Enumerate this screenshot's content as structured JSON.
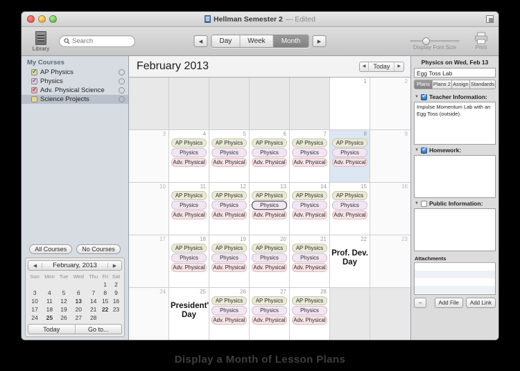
{
  "window": {
    "title": "Hellman Semester 2",
    "edited_suffix": "— Edited",
    "doc_icon": "document-icon",
    "fullscreen_icon": "fullscreen-icon"
  },
  "toolbar": {
    "library_label": "Library",
    "library_icon": "library-icon",
    "search_placeholder": "Search",
    "search_value": "",
    "search_icon": "search-icon",
    "prev_icon": "chevron-left-icon",
    "next_icon": "chevron-right-icon",
    "views": [
      {
        "label": "Day",
        "active": false
      },
      {
        "label": "Week",
        "active": false
      },
      {
        "label": "Month",
        "active": true
      }
    ],
    "font_size_label": "Display Font Size",
    "print_label": "Print",
    "print_icon": "printer-icon"
  },
  "sidebar": {
    "header": "My Courses",
    "items": [
      {
        "label": "AP Physics",
        "checked": true,
        "color": "#e9e9d6",
        "selected": false,
        "gear_icon": "gear-icon"
      },
      {
        "label": "Physics",
        "checked": true,
        "color": "#f1e6f1",
        "selected": false,
        "gear_icon": "gear-icon"
      },
      {
        "label": "Adv. Physical Science",
        "checked": true,
        "color": "#f6e3e5",
        "selected": false,
        "gear_icon": "gear-icon"
      },
      {
        "label": "Science Projects",
        "checked": false,
        "color": "#e8d98a",
        "selected": true,
        "gear_icon": "gear-icon"
      }
    ],
    "all_courses_label": "All Courses",
    "no_courses_label": "No Courses",
    "mini_calendar": {
      "title": "February, 2013",
      "prev_icon": "chevron-left-icon",
      "next_icon": "chevron-right-icon",
      "weekday_headers": [
        "Sun",
        "Mon",
        "Tue",
        "Wed",
        "Thu",
        "Fri",
        "Sat"
      ],
      "weeks": [
        [
          {
            "d": "",
            "style": "dim"
          },
          {
            "d": "",
            "style": "dim"
          },
          {
            "d": "",
            "style": "dim"
          },
          {
            "d": "",
            "style": "dim"
          },
          {
            "d": "",
            "style": "dim"
          },
          {
            "d": "1",
            "style": "dim"
          },
          {
            "d": "2",
            "style": "dim"
          }
        ],
        [
          {
            "d": "3",
            "style": "dim"
          },
          {
            "d": "4",
            "style": ""
          },
          {
            "d": "5",
            "style": ""
          },
          {
            "d": "6",
            "style": ""
          },
          {
            "d": "7",
            "style": ""
          },
          {
            "d": "8",
            "style": "blue"
          },
          {
            "d": "9",
            "style": "dim"
          }
        ],
        [
          {
            "d": "10",
            "style": "dim"
          },
          {
            "d": "11",
            "style": ""
          },
          {
            "d": "12",
            "style": ""
          },
          {
            "d": "13",
            "style": "today"
          },
          {
            "d": "14",
            "style": ""
          },
          {
            "d": "15",
            "style": ""
          },
          {
            "d": "16",
            "style": "dim"
          }
        ],
        [
          {
            "d": "17",
            "style": "dim"
          },
          {
            "d": "18",
            "style": ""
          },
          {
            "d": "19",
            "style": ""
          },
          {
            "d": "20",
            "style": ""
          },
          {
            "d": "21",
            "style": ""
          },
          {
            "d": "22",
            "style": "green"
          },
          {
            "d": "23",
            "style": "dim"
          }
        ],
        [
          {
            "d": "24",
            "style": "dim"
          },
          {
            "d": "25",
            "style": "green"
          },
          {
            "d": "26",
            "style": ""
          },
          {
            "d": "27",
            "style": ""
          },
          {
            "d": "28",
            "style": ""
          },
          {
            "d": "",
            "style": "dim"
          },
          {
            "d": "",
            "style": "dim"
          }
        ]
      ],
      "today_label": "Today",
      "goto_label": "Go to..."
    }
  },
  "calendar": {
    "title": "February 2013",
    "prev_icon": "chevron-left-icon",
    "next_icon": "chevron-right-icon",
    "today_label": "Today",
    "weeks": [
      [
        {
          "day": "",
          "state": "outside",
          "events": []
        },
        {
          "day": "",
          "state": "outside",
          "events": []
        },
        {
          "day": "",
          "state": "outside",
          "events": []
        },
        {
          "day": "",
          "state": "outside",
          "events": []
        },
        {
          "day": "",
          "state": "outside",
          "events": []
        },
        {
          "day": "1",
          "state": "normal",
          "events": []
        },
        {
          "day": "2",
          "state": "weekend",
          "events": []
        }
      ],
      [
        {
          "day": "3",
          "state": "weekend",
          "events": []
        },
        {
          "day": "4",
          "state": "normal",
          "events": [
            {
              "label": "AP Physics",
              "cls": "ap"
            },
            {
              "label": "Physics",
              "cls": "phys"
            },
            {
              "label": "Adv. Physical",
              "cls": "advp"
            }
          ]
        },
        {
          "day": "5",
          "state": "normal",
          "events": [
            {
              "label": "AP Physics",
              "cls": "ap"
            },
            {
              "label": "Physics",
              "cls": "phys"
            },
            {
              "label": "Adv. Physical",
              "cls": "advp"
            }
          ]
        },
        {
          "day": "6",
          "state": "normal",
          "events": [
            {
              "label": "AP Physics",
              "cls": "ap"
            },
            {
              "label": "Physics",
              "cls": "phys"
            },
            {
              "label": "Adv. Physical",
              "cls": "advp"
            }
          ]
        },
        {
          "day": "7",
          "state": "normal",
          "events": [
            {
              "label": "AP Physics",
              "cls": "ap"
            },
            {
              "label": "Physics",
              "cls": "phys"
            },
            {
              "label": "Adv. Physical",
              "cls": "advp"
            }
          ]
        },
        {
          "day": "8",
          "state": "highlight",
          "events": [
            {
              "label": "AP Physics",
              "cls": "ap"
            },
            {
              "label": "Physics",
              "cls": "phys"
            },
            {
              "label": "Adv. Physical",
              "cls": "advp"
            }
          ]
        },
        {
          "day": "9",
          "state": "weekend",
          "events": []
        }
      ],
      [
        {
          "day": "10",
          "state": "weekend",
          "events": []
        },
        {
          "day": "11",
          "state": "normal",
          "events": [
            {
              "label": "AP Physics",
              "cls": "ap"
            },
            {
              "label": "Physics",
              "cls": "phys"
            },
            {
              "label": "Adv. Physical",
              "cls": "advp"
            }
          ]
        },
        {
          "day": "12",
          "state": "normal",
          "events": [
            {
              "label": "AP Physics",
              "cls": "ap"
            },
            {
              "label": "Physics",
              "cls": "phys"
            },
            {
              "label": "Adv. Physical",
              "cls": "advp"
            }
          ]
        },
        {
          "day": "13",
          "state": "normal",
          "events": [
            {
              "label": "AP Physics",
              "cls": "ap"
            },
            {
              "label": "Physics",
              "cls": "phys",
              "selected": true
            },
            {
              "label": "Adv. Physical",
              "cls": "advp"
            }
          ]
        },
        {
          "day": "14",
          "state": "normal",
          "events": [
            {
              "label": "AP Physics",
              "cls": "ap"
            },
            {
              "label": "Physics",
              "cls": "phys"
            },
            {
              "label": "Adv. Physical",
              "cls": "advp"
            }
          ]
        },
        {
          "day": "15",
          "state": "normal",
          "events": [
            {
              "label": "AP Physics",
              "cls": "ap"
            },
            {
              "label": "Physics",
              "cls": "phys"
            },
            {
              "label": "Adv. Physical",
              "cls": "advp"
            }
          ]
        },
        {
          "day": "16",
          "state": "weekend",
          "events": []
        }
      ],
      [
        {
          "day": "17",
          "state": "weekend",
          "events": []
        },
        {
          "day": "18",
          "state": "normal",
          "events": [
            {
              "label": "AP Physics",
              "cls": "ap"
            },
            {
              "label": "Physics",
              "cls": "phys"
            },
            {
              "label": "Adv. Physical",
              "cls": "advp"
            }
          ]
        },
        {
          "day": "19",
          "state": "normal",
          "events": [
            {
              "label": "AP Physics",
              "cls": "ap"
            },
            {
              "label": "Physics",
              "cls": "phys"
            },
            {
              "label": "Adv. Physical",
              "cls": "advp"
            }
          ]
        },
        {
          "day": "20",
          "state": "normal",
          "events": [
            {
              "label": "AP Physics",
              "cls": "ap"
            },
            {
              "label": "Physics",
              "cls": "phys"
            },
            {
              "label": "Adv. Physical",
              "cls": "advp"
            }
          ]
        },
        {
          "day": "21",
          "state": "normal",
          "events": [
            {
              "label": "AP Physics",
              "cls": "ap"
            },
            {
              "label": "Physics",
              "cls": "phys"
            },
            {
              "label": "Adv. Physical",
              "cls": "advp"
            }
          ]
        },
        {
          "day": "22",
          "state": "normal",
          "events": [],
          "holiday": "Prof. Dev. Day"
        },
        {
          "day": "23",
          "state": "weekend",
          "events": []
        }
      ],
      [
        {
          "day": "24",
          "state": "weekend",
          "events": []
        },
        {
          "day": "25",
          "state": "normal",
          "events": [],
          "holiday": "President's Day"
        },
        {
          "day": "26",
          "state": "normal",
          "events": [
            {
              "label": "AP Physics",
              "cls": "ap"
            },
            {
              "label": "Physics",
              "cls": "phys"
            },
            {
              "label": "Adv. Physical",
              "cls": "advp"
            }
          ]
        },
        {
          "day": "27",
          "state": "normal",
          "events": [
            {
              "label": "AP Physics",
              "cls": "ap"
            },
            {
              "label": "Physics",
              "cls": "phys"
            },
            {
              "label": "Adv. Physical",
              "cls": "advp"
            }
          ]
        },
        {
          "day": "28",
          "state": "normal",
          "events": [
            {
              "label": "AP Physics",
              "cls": "ap"
            },
            {
              "label": "Physics",
              "cls": "phys"
            },
            {
              "label": "Adv. Physical",
              "cls": "advp"
            }
          ]
        },
        {
          "day": "",
          "state": "outside",
          "events": []
        },
        {
          "day": "",
          "state": "outside",
          "events": []
        }
      ]
    ]
  },
  "inspector": {
    "title": "Physics on Wed, Feb 13",
    "name_value": "Egg Toss Lab",
    "tabs": [
      {
        "label": "Plans",
        "active": true
      },
      {
        "label": "Plans 2",
        "active": false
      },
      {
        "label": "Assign",
        "active": false
      },
      {
        "label": "Standards",
        "active": false
      }
    ],
    "sections": [
      {
        "label": "Teacher Information:",
        "checked": true,
        "text": "Impulse Momentum Lab with an Egg Toss (outside)."
      },
      {
        "label": "Homework:",
        "checked": true,
        "text": ""
      },
      {
        "label": "Public Information:",
        "checked": false,
        "text": ""
      }
    ],
    "attachments_label": "Attachments",
    "remove_label": "–",
    "add_file_label": "Add File",
    "add_link_label": "Add Link"
  },
  "caption": "Display a Month of Lesson Plans"
}
